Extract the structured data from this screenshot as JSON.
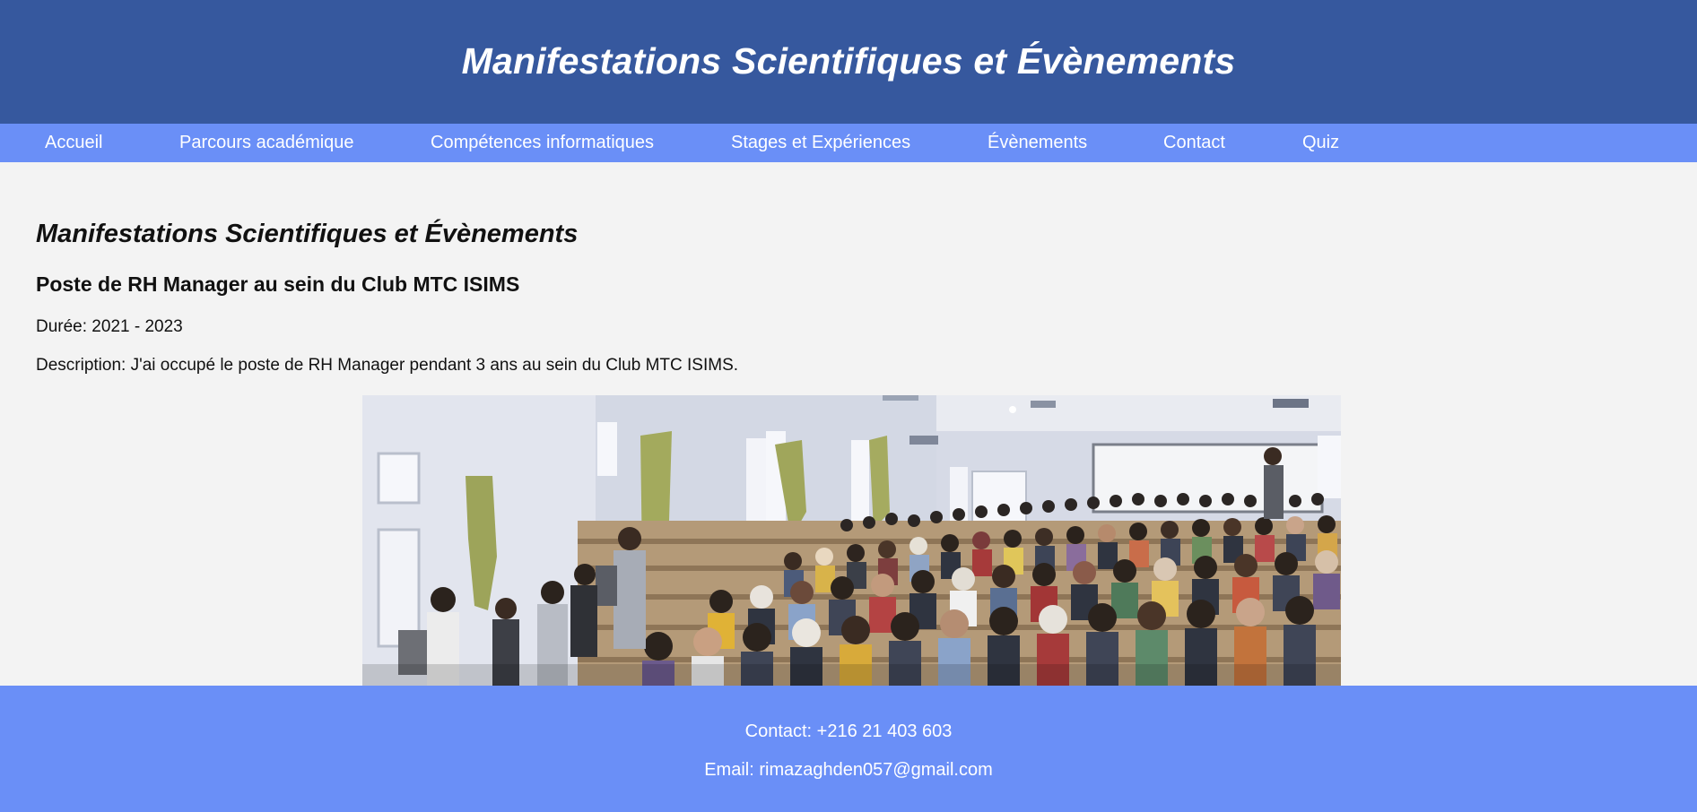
{
  "header": {
    "title": "Manifestations Scientifiques et Évènements"
  },
  "nav": {
    "items": [
      {
        "label": "Accueil"
      },
      {
        "label": "Parcours académique"
      },
      {
        "label": "Compétences informatiques"
      },
      {
        "label": "Stages et Expériences"
      },
      {
        "label": "Évènements"
      },
      {
        "label": "Contact"
      },
      {
        "label": "Quiz"
      }
    ]
  },
  "main": {
    "section_title": "Manifestations Scientifiques et Évènements",
    "event": {
      "title": "Poste de RH Manager au sein du Club MTC ISIMS",
      "duration": "Durée: 2021 - 2023",
      "description": "Description: J'ai occupé le poste de RH Manager pendant 3 ans au sein du Club MTC ISIMS."
    }
  },
  "footer": {
    "contact": "Contact: +216 21 403 603",
    "email": "Email: rimazaghden057@gmail.com"
  },
  "colors": {
    "header_bg": "#36589e",
    "nav_bg": "#6a8ff7",
    "footer_bg": "#6a8ff7",
    "page_bg": "#f3f3f3"
  }
}
